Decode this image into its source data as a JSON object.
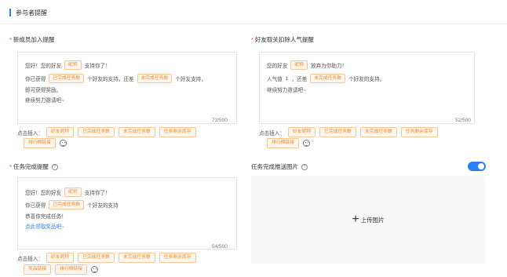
{
  "header": {
    "title": "参与者提醒"
  },
  "new_member": {
    "label": "新成员加入提醒",
    "lines": [
      {
        "before": "您好！您的好友",
        "chip": "昵称",
        "after": "支持你了！"
      },
      {
        "before": "你已获得",
        "chip": "已完成任务数",
        "after": "个好友的支持，还差",
        "chip2": "未完成任务数",
        "after2": "个好友支持，"
      },
      {
        "before": "即可获得奖励。"
      },
      {
        "before": "继续努力邀请吧~"
      }
    ],
    "counter": "72/500",
    "insert_label": "点击插入：",
    "tags": [
      "好友昵称",
      "已完成任务数",
      "未完成任务数",
      "任务剩余库存",
      "排行榜链接"
    ]
  },
  "friend_cancel": {
    "label": "好友取关扣除人气提醒",
    "lines": [
      {
        "before": "您的好友",
        "chip": "昵称",
        "after": "放弃为你助力！"
      },
      {
        "before": "人气值",
        "mid": "1",
        "after": "，还差",
        "chip": "未完成任务数",
        "after2": "个好友的支持。"
      },
      {
        "before": "继续努力邀请吧~"
      }
    ],
    "counter": "52/500",
    "insert_label": "点击插入：",
    "tags": [
      "好友昵称",
      "已完成任务数",
      "未完成任务数",
      "任务剩余库存",
      "排行榜链接"
    ]
  },
  "task_complete": {
    "label": "任务完成提醒",
    "lines": [
      {
        "before": "您好！您的好友",
        "chip": "昵称",
        "after": "支持你了！"
      },
      {
        "before": "你已获得",
        "chip": "已完成任务数",
        "after": "个好友的支持"
      },
      {
        "before": "恭喜你完成任务！"
      },
      {
        "before": "点此领取奖品吧~"
      }
    ],
    "counter": "54/500",
    "insert_label": "点击插入：",
    "tags": [
      "好友昵称",
      "已完成任务数",
      "未完成任务数",
      "任务剩余库存",
      "奖品链接",
      "排行榜链接"
    ]
  },
  "push_image": {
    "label": "任务完成推送图片",
    "toggle_on": true,
    "upload_text": "上传图片"
  },
  "colors": {
    "accent": "#2d7ff9",
    "tag_text": "#f0882a",
    "tag_border": "#f7c79a",
    "tag_bg": "#fff7ee",
    "required": "#e53935"
  }
}
